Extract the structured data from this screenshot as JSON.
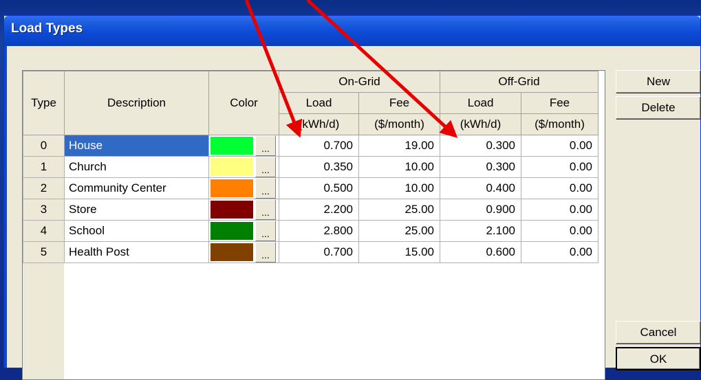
{
  "window": {
    "title": "Load Types"
  },
  "grid": {
    "group_headers": {
      "on_grid": "On-Grid",
      "off_grid": "Off-Grid"
    },
    "columns": {
      "type": "Type",
      "description": "Description",
      "color": "Color",
      "on_load": "Load",
      "on_load_unit": "(kWh/d)",
      "on_fee": "Fee",
      "on_fee_unit": "($/month)",
      "off_load": "Load",
      "off_load_unit": "(kWh/d)",
      "off_fee": "Fee",
      "off_fee_unit": "($/month)"
    },
    "color_button_label": "...",
    "rows": [
      {
        "type": "0",
        "description": "House",
        "color": "#00ff33",
        "on_load": "0.700",
        "on_fee": "19.00",
        "off_load": "0.300",
        "off_fee": "0.00",
        "selected": true
      },
      {
        "type": "1",
        "description": "Church",
        "color": "#ffff80",
        "on_load": "0.350",
        "on_fee": "10.00",
        "off_load": "0.300",
        "off_fee": "0.00"
      },
      {
        "type": "2",
        "description": "Community Center",
        "color": "#ff8000",
        "on_load": "0.500",
        "on_fee": "10.00",
        "off_load": "0.400",
        "off_fee": "0.00"
      },
      {
        "type": "3",
        "description": "Store",
        "color": "#800000",
        "on_load": "2.200",
        "on_fee": "25.00",
        "off_load": "0.900",
        "off_fee": "0.00"
      },
      {
        "type": "4",
        "description": "School",
        "color": "#008000",
        "on_load": "2.800",
        "on_fee": "25.00",
        "off_load": "2.100",
        "off_fee": "0.00"
      },
      {
        "type": "5",
        "description": "Health Post",
        "color": "#804000",
        "on_load": "0.700",
        "on_fee": "15.00",
        "off_load": "0.600",
        "off_fee": "0.00"
      }
    ]
  },
  "buttons": {
    "new": "New",
    "delete": "Delete",
    "cancel": "Cancel",
    "ok": "OK"
  },
  "annotation": {
    "arrow_color": "#e60000"
  }
}
